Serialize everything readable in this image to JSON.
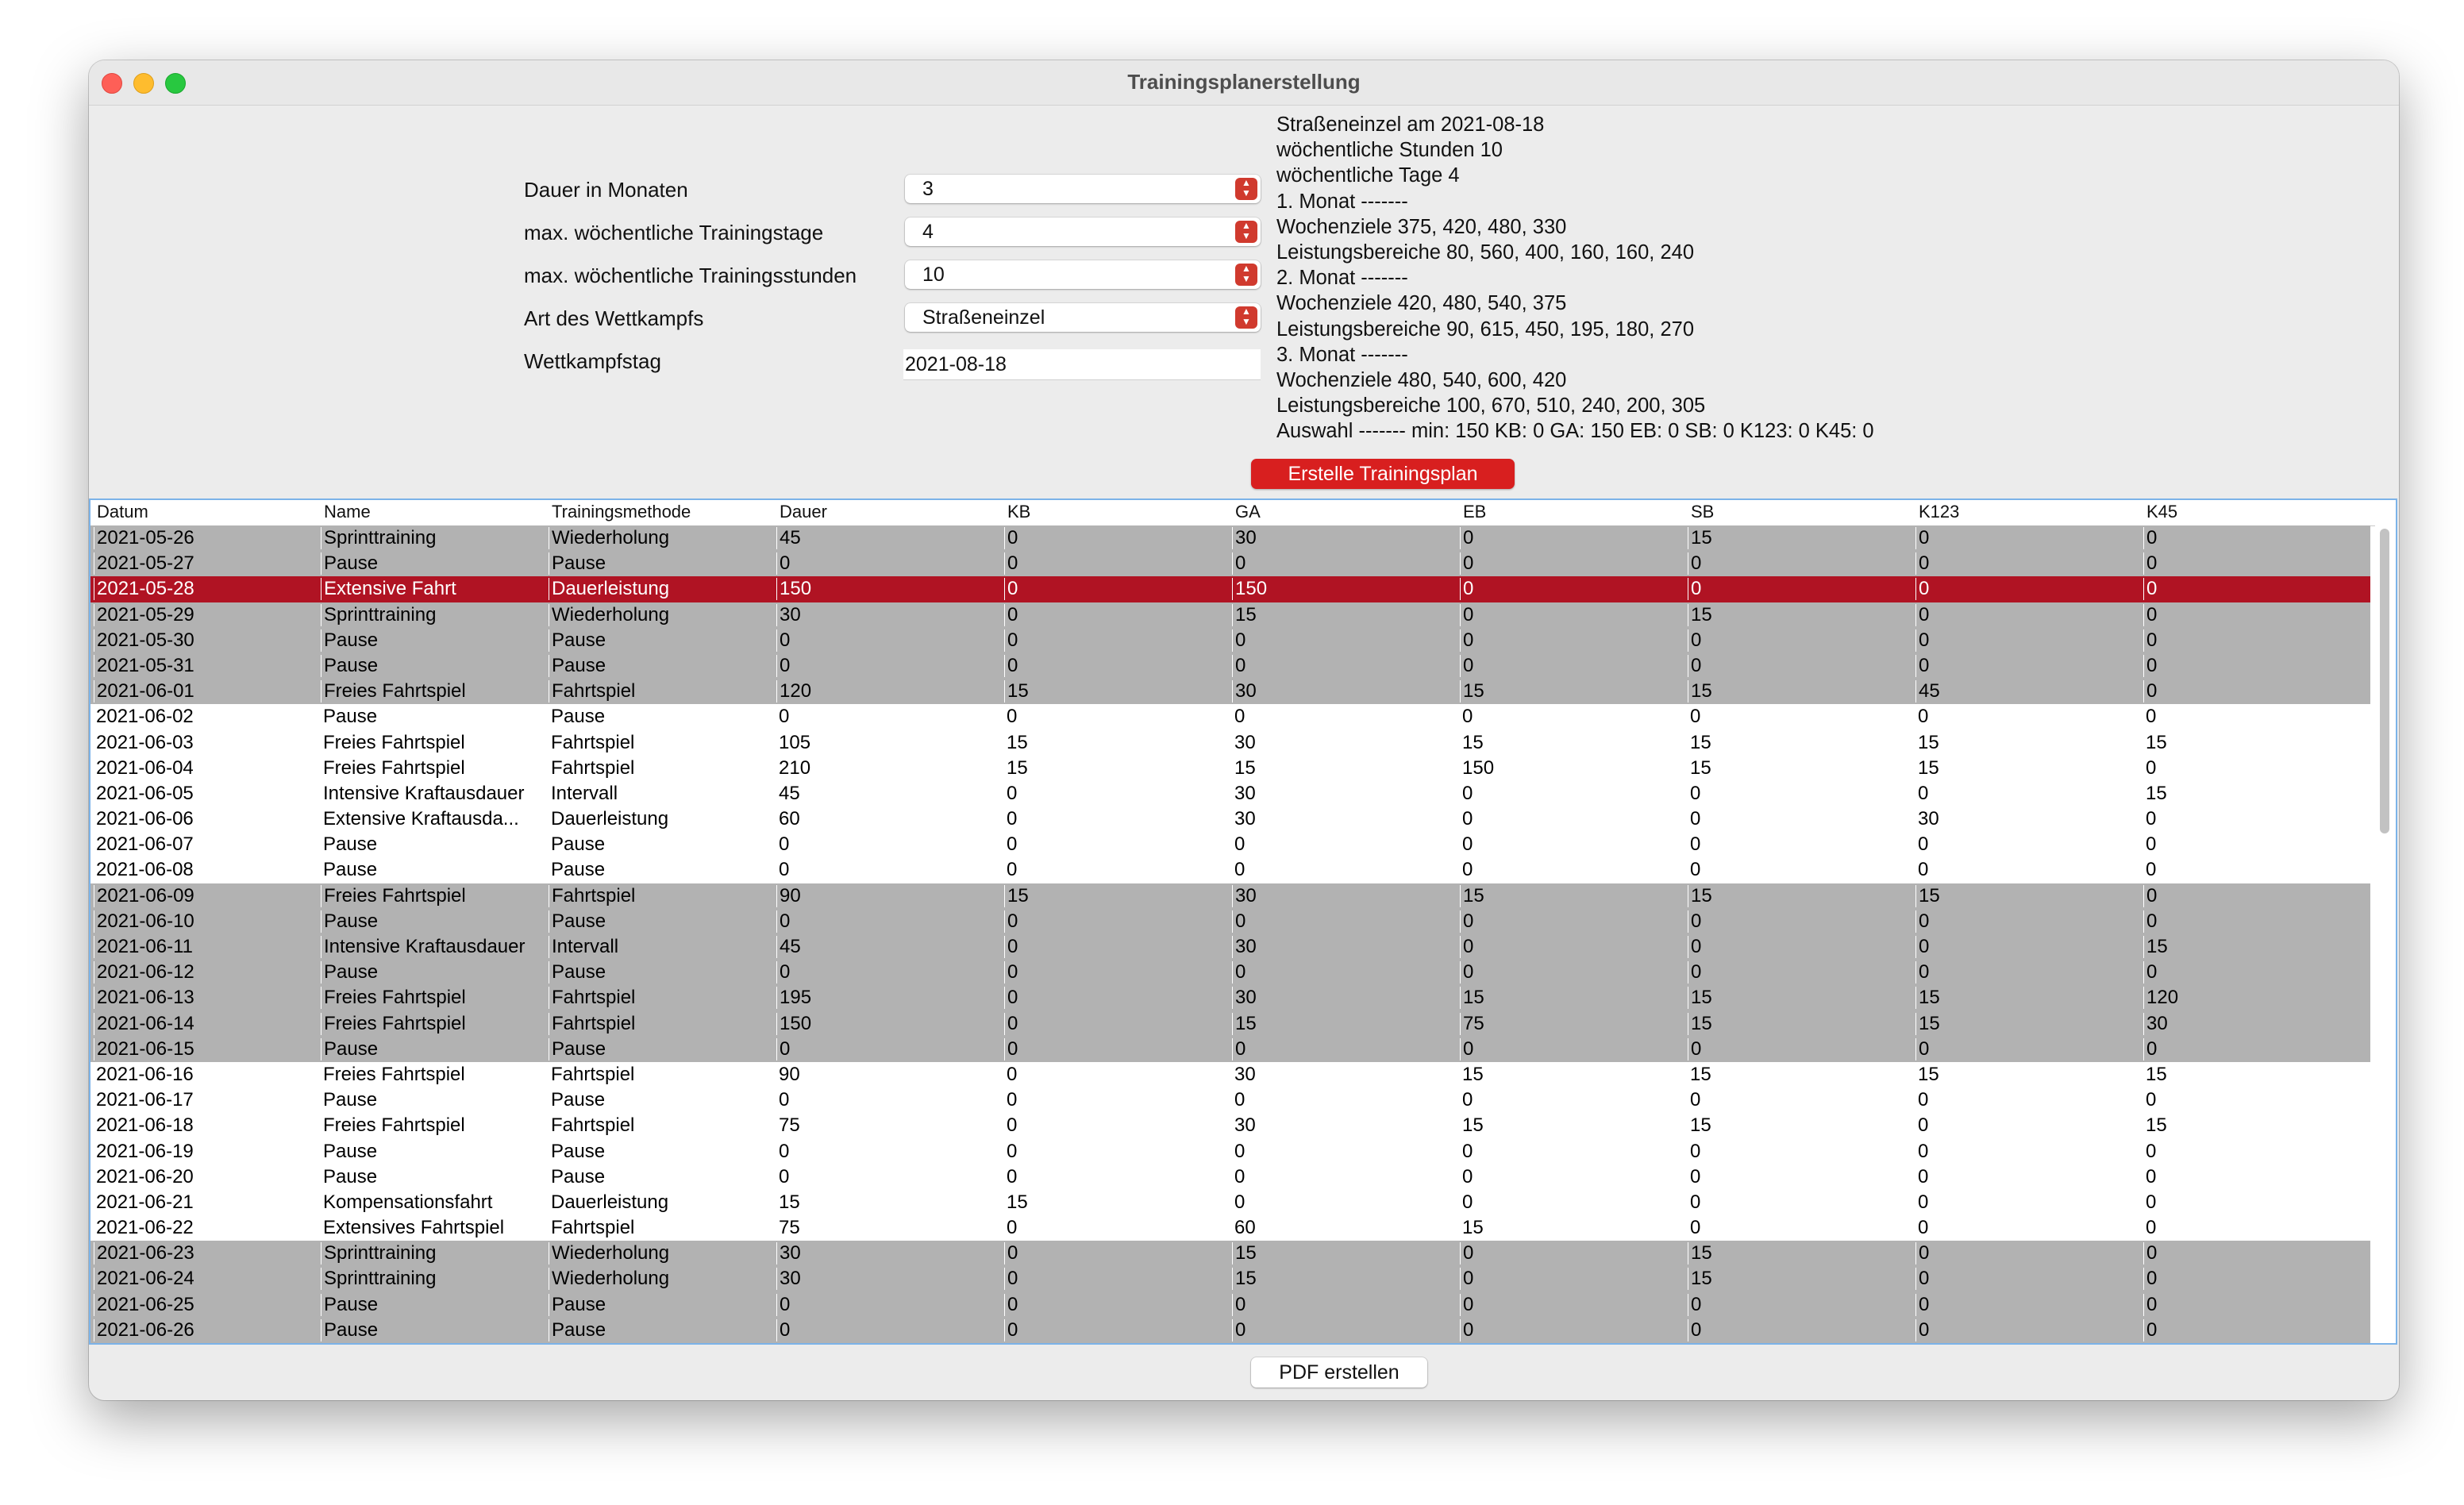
{
  "window": {
    "title": "Trainingsplanerstellung"
  },
  "form": {
    "duration_label": "Dauer in Monaten",
    "duration_value": "3",
    "days_label": "max. wöchentliche Trainingstage",
    "days_value": "4",
    "hours_label": "max. wöchentliche Trainingsstunden",
    "hours_value": "10",
    "type_label": "Art des Wettkampfs",
    "type_value": "Straßeneinzel",
    "date_label": "Wettkampfstag",
    "date_value": "2021-08-18"
  },
  "summary": [
    "Straßeneinzel am 2021-08-18",
    "wöchentliche Stunden 10",
    "wöchentliche Tage 4",
    "1. Monat -------",
    "Wochenziele 375, 420, 480, 330",
    "Leistungsbereiche 80, 560, 400, 160, 160, 240",
    "2. Monat -------",
    "Wochenziele 420, 480, 540, 375",
    "Leistungsbereiche 90, 615, 450, 195, 180, 270",
    "3. Monat -------",
    "Wochenziele 480, 540, 600, 420",
    "Leistungsbereiche 100, 670, 510, 240, 200, 305",
    "Auswahl ------- min: 150 KB: 0 GA: 150 EB: 0 SB: 0 K123: 0 K45: 0"
  ],
  "buttons": {
    "create": "Erstelle Trainingsplan",
    "pdf": "PDF erstellen"
  },
  "table": {
    "columns": [
      "Datum",
      "Name",
      "Trainingsmethode",
      "Dauer",
      "KB",
      "GA",
      "EB",
      "SB",
      "K123",
      "K45"
    ],
    "rows": [
      {
        "style": "shaded",
        "cells": [
          "2021-05-26",
          "Sprinttraining",
          "Wiederholung",
          "45",
          "0",
          "30",
          "0",
          "15",
          "0",
          "0"
        ]
      },
      {
        "style": "shaded",
        "cells": [
          "2021-05-27",
          "Pause",
          "Pause",
          "0",
          "0",
          "0",
          "0",
          "0",
          "0",
          "0"
        ]
      },
      {
        "style": "sel",
        "cells": [
          "2021-05-28",
          "Extensive Fahrt",
          "Dauerleistung",
          "150",
          "0",
          "150",
          "0",
          "0",
          "0",
          "0"
        ]
      },
      {
        "style": "shaded",
        "cells": [
          "2021-05-29",
          "Sprinttraining",
          "Wiederholung",
          "30",
          "0",
          "15",
          "0",
          "15",
          "0",
          "0"
        ]
      },
      {
        "style": "shaded",
        "cells": [
          "2021-05-30",
          "Pause",
          "Pause",
          "0",
          "0",
          "0",
          "0",
          "0",
          "0",
          "0"
        ]
      },
      {
        "style": "shaded",
        "cells": [
          "2021-05-31",
          "Pause",
          "Pause",
          "0",
          "0",
          "0",
          "0",
          "0",
          "0",
          "0"
        ]
      },
      {
        "style": "shaded",
        "cells": [
          "2021-06-01",
          "Freies Fahrtspiel",
          "Fahrtspiel",
          "120",
          "15",
          "30",
          "15",
          "15",
          "45",
          "0"
        ]
      },
      {
        "style": "plain",
        "cells": [
          "2021-06-02",
          "Pause",
          "Pause",
          "0",
          "0",
          "0",
          "0",
          "0",
          "0",
          "0"
        ]
      },
      {
        "style": "plain",
        "cells": [
          "2021-06-03",
          "Freies Fahrtspiel",
          "Fahrtspiel",
          "105",
          "15",
          "30",
          "15",
          "15",
          "15",
          "15"
        ]
      },
      {
        "style": "plain",
        "cells": [
          "2021-06-04",
          "Freies Fahrtspiel",
          "Fahrtspiel",
          "210",
          "15",
          "15",
          "150",
          "15",
          "15",
          "0"
        ]
      },
      {
        "style": "plain",
        "cells": [
          "2021-06-05",
          "Intensive Kraftausdauer",
          "Intervall",
          "45",
          "0",
          "30",
          "0",
          "0",
          "0",
          "15"
        ]
      },
      {
        "style": "plain",
        "cells": [
          "2021-06-06",
          "Extensive Kraftausda...",
          "Dauerleistung",
          "60",
          "0",
          "30",
          "0",
          "0",
          "30",
          "0"
        ]
      },
      {
        "style": "plain",
        "cells": [
          "2021-06-07",
          "Pause",
          "Pause",
          "0",
          "0",
          "0",
          "0",
          "0",
          "0",
          "0"
        ]
      },
      {
        "style": "plain",
        "cells": [
          "2021-06-08",
          "Pause",
          "Pause",
          "0",
          "0",
          "0",
          "0",
          "0",
          "0",
          "0"
        ]
      },
      {
        "style": "shaded",
        "cells": [
          "2021-06-09",
          "Freies Fahrtspiel",
          "Fahrtspiel",
          "90",
          "15",
          "30",
          "15",
          "15",
          "15",
          "0"
        ]
      },
      {
        "style": "shaded",
        "cells": [
          "2021-06-10",
          "Pause",
          "Pause",
          "0",
          "0",
          "0",
          "0",
          "0",
          "0",
          "0"
        ]
      },
      {
        "style": "shaded",
        "cells": [
          "2021-06-11",
          "Intensive Kraftausdauer",
          "Intervall",
          "45",
          "0",
          "30",
          "0",
          "0",
          "0",
          "15"
        ]
      },
      {
        "style": "shaded",
        "cells": [
          "2021-06-12",
          "Pause",
          "Pause",
          "0",
          "0",
          "0",
          "0",
          "0",
          "0",
          "0"
        ]
      },
      {
        "style": "shaded",
        "cells": [
          "2021-06-13",
          "Freies Fahrtspiel",
          "Fahrtspiel",
          "195",
          "0",
          "30",
          "15",
          "15",
          "15",
          "120"
        ]
      },
      {
        "style": "shaded",
        "cells": [
          "2021-06-14",
          "Freies Fahrtspiel",
          "Fahrtspiel",
          "150",
          "0",
          "15",
          "75",
          "15",
          "15",
          "30"
        ]
      },
      {
        "style": "shaded",
        "cells": [
          "2021-06-15",
          "Pause",
          "Pause",
          "0",
          "0",
          "0",
          "0",
          "0",
          "0",
          "0"
        ]
      },
      {
        "style": "plain",
        "cells": [
          "2021-06-16",
          "Freies Fahrtspiel",
          "Fahrtspiel",
          "90",
          "0",
          "30",
          "15",
          "15",
          "15",
          "15"
        ]
      },
      {
        "style": "plain",
        "cells": [
          "2021-06-17",
          "Pause",
          "Pause",
          "0",
          "0",
          "0",
          "0",
          "0",
          "0",
          "0"
        ]
      },
      {
        "style": "plain",
        "cells": [
          "2021-06-18",
          "Freies Fahrtspiel",
          "Fahrtspiel",
          "75",
          "0",
          "30",
          "15",
          "15",
          "0",
          "15"
        ]
      },
      {
        "style": "plain",
        "cells": [
          "2021-06-19",
          "Pause",
          "Pause",
          "0",
          "0",
          "0",
          "0",
          "0",
          "0",
          "0"
        ]
      },
      {
        "style": "plain",
        "cells": [
          "2021-06-20",
          "Pause",
          "Pause",
          "0",
          "0",
          "0",
          "0",
          "0",
          "0",
          "0"
        ]
      },
      {
        "style": "plain",
        "cells": [
          "2021-06-21",
          "Kompensationsfahrt",
          "Dauerleistung",
          "15",
          "15",
          "0",
          "0",
          "0",
          "0",
          "0"
        ]
      },
      {
        "style": "plain",
        "cells": [
          "2021-06-22",
          "Extensives Fahrtspiel",
          "Fahrtspiel",
          "75",
          "0",
          "60",
          "15",
          "0",
          "0",
          "0"
        ]
      },
      {
        "style": "shaded",
        "cells": [
          "2021-06-23",
          "Sprinttraining",
          "Wiederholung",
          "30",
          "0",
          "15",
          "0",
          "15",
          "0",
          "0"
        ]
      },
      {
        "style": "shaded",
        "cells": [
          "2021-06-24",
          "Sprinttraining",
          "Wiederholung",
          "30",
          "0",
          "15",
          "0",
          "15",
          "0",
          "0"
        ]
      },
      {
        "style": "shaded",
        "cells": [
          "2021-06-25",
          "Pause",
          "Pause",
          "0",
          "0",
          "0",
          "0",
          "0",
          "0",
          "0"
        ]
      },
      {
        "style": "shaded",
        "cells": [
          "2021-06-26",
          "Pause",
          "Pause",
          "0",
          "0",
          "0",
          "0",
          "0",
          "0",
          "0"
        ]
      }
    ]
  }
}
